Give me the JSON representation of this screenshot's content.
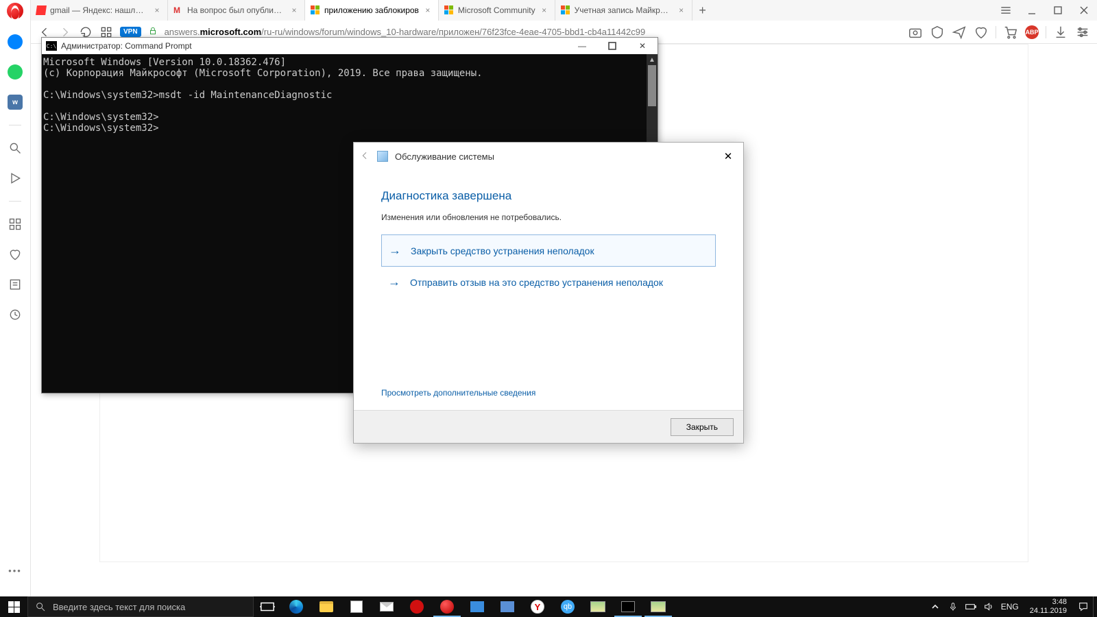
{
  "opera": {
    "tabs": [
      {
        "label": "gmail — Яндекс: нашлось",
        "icon": "yandex"
      },
      {
        "label": "На вопрос был опубликов",
        "icon": "gmail"
      },
      {
        "label": "приложению заблокиров",
        "icon": "microsoft",
        "active": true
      },
      {
        "label": "Microsoft Community",
        "icon": "microsoft"
      },
      {
        "label": "Учетная запись Майкросо",
        "icon": "microsoft"
      }
    ],
    "url_host": "answers.microsoft.com",
    "url_path": "/ru-ru/windows/forum/windows_10-hardware/приложен/76f23fce-4eae-4705-bbd1-cb4a11442c99",
    "vpn": "VPN",
    "abp": "ABP"
  },
  "side_icons": [
    "messenger",
    "whatsapp",
    "vk",
    "sep",
    "search",
    "play",
    "sep",
    "speed-dial",
    "heart",
    "news",
    "history"
  ],
  "cmd": {
    "title": "Администратор: Command Prompt",
    "lines": [
      "Microsoft Windows [Version 10.0.18362.476]",
      "(c) Корпорация Майкрософт (Microsoft Corporation), 2019. Все права защищены.",
      "",
      "C:\\Windows\\system32>msdt -id MaintenanceDiagnostic",
      "",
      "C:\\Windows\\system32>",
      "C:\\Windows\\system32>"
    ]
  },
  "dlg": {
    "caption": "Обслуживание системы",
    "heading": "Диагностика завершена",
    "sub": "Изменения или обновления не потребовались.",
    "opt1": "Закрыть средство устранения неполадок",
    "opt2": "Отправить отзыв на это средство устранения неполадок",
    "link": "Просмотреть дополнительные сведения",
    "close_btn": "Закрыть"
  },
  "taskbar": {
    "search_placeholder": "Введите здесь текст для поиска",
    "lang": "ENG",
    "time": "3:48",
    "date": "24.11.2019"
  }
}
